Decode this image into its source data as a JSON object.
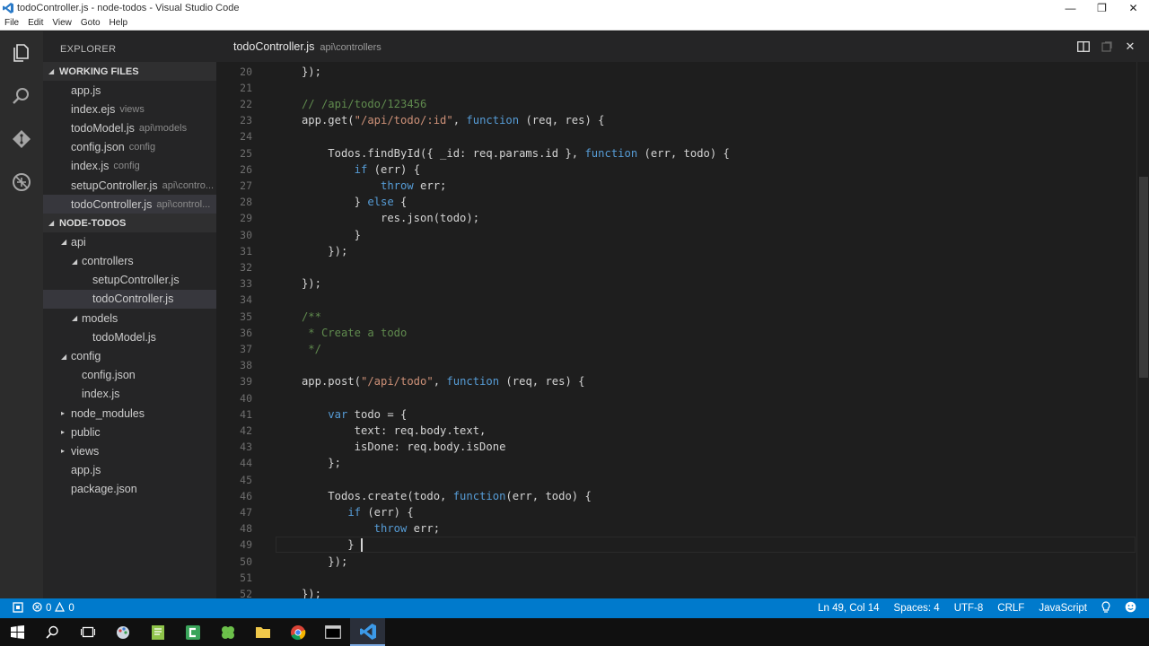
{
  "window": {
    "title": "todoController.js - node-todos - Visual Studio Code",
    "controls": [
      "—",
      "❐",
      "✕"
    ]
  },
  "menu": [
    "File",
    "Edit",
    "View",
    "Goto",
    "Help"
  ],
  "sidebar": {
    "header": "EXPLORER",
    "working_files_label": "WORKING FILES",
    "working_files": [
      {
        "name": "app.js",
        "hint": ""
      },
      {
        "name": "index.ejs",
        "hint": "views"
      },
      {
        "name": "todoModel.js",
        "hint": "api\\models"
      },
      {
        "name": "config.json",
        "hint": "config"
      },
      {
        "name": "index.js",
        "hint": "config"
      },
      {
        "name": "setupController.js",
        "hint": "api\\contro..."
      },
      {
        "name": "todoController.js",
        "hint": "api\\control..."
      }
    ],
    "project_label": "NODE-TODOS",
    "tree": [
      {
        "name": "api",
        "depth": 1,
        "toggle": "open"
      },
      {
        "name": "controllers",
        "depth": 2,
        "toggle": "open"
      },
      {
        "name": "setupController.js",
        "depth": 3,
        "toggle": ""
      },
      {
        "name": "todoController.js",
        "depth": 3,
        "toggle": "",
        "selected": true
      },
      {
        "name": "models",
        "depth": 2,
        "toggle": "open"
      },
      {
        "name": "todoModel.js",
        "depth": 3,
        "toggle": ""
      },
      {
        "name": "config",
        "depth": 1,
        "toggle": "open"
      },
      {
        "name": "config.json",
        "depth": 2,
        "toggle": ""
      },
      {
        "name": "index.js",
        "depth": 2,
        "toggle": ""
      },
      {
        "name": "node_modules",
        "depth": 1,
        "toggle": "closed"
      },
      {
        "name": "public",
        "depth": 1,
        "toggle": "closed"
      },
      {
        "name": "views",
        "depth": 1,
        "toggle": "closed"
      },
      {
        "name": "app.js",
        "depth": 1,
        "toggle": ""
      },
      {
        "name": "package.json",
        "depth": 1,
        "toggle": ""
      }
    ]
  },
  "tab": {
    "name": "todoController.js",
    "path": "api\\controllers"
  },
  "editor": {
    "lines": [
      {
        "n": "20",
        "tokens": [
          [
            "    });",
            ""
          ]
        ]
      },
      {
        "n": "21",
        "tokens": []
      },
      {
        "n": "22",
        "tokens": [
          [
            "    // /api/todo/123456",
            "cm"
          ]
        ]
      },
      {
        "n": "23",
        "tokens": [
          [
            "    app.get(",
            ""
          ],
          [
            "\"/api/todo/:id\"",
            "str"
          ],
          [
            ", ",
            ""
          ],
          [
            "function",
            "kw"
          ],
          [
            " (req, res) {",
            ""
          ]
        ]
      },
      {
        "n": "24",
        "tokens": []
      },
      {
        "n": "25",
        "tokens": [
          [
            "        Todos.findById({ _id: req.params.id }, ",
            ""
          ],
          [
            "function",
            "kw"
          ],
          [
            " (err, todo) {",
            ""
          ]
        ]
      },
      {
        "n": "26",
        "tokens": [
          [
            "            ",
            ""
          ],
          [
            "if",
            "kw"
          ],
          [
            " (err) {",
            ""
          ]
        ]
      },
      {
        "n": "27",
        "tokens": [
          [
            "                ",
            ""
          ],
          [
            "throw",
            "kw"
          ],
          [
            " err;",
            ""
          ]
        ]
      },
      {
        "n": "28",
        "tokens": [
          [
            "            } ",
            ""
          ],
          [
            "else",
            "kw"
          ],
          [
            " {",
            ""
          ]
        ]
      },
      {
        "n": "29",
        "tokens": [
          [
            "                res.json(todo);",
            ""
          ]
        ]
      },
      {
        "n": "30",
        "tokens": [
          [
            "            }",
            ""
          ]
        ]
      },
      {
        "n": "31",
        "tokens": [
          [
            "        });",
            ""
          ]
        ]
      },
      {
        "n": "32",
        "tokens": []
      },
      {
        "n": "33",
        "tokens": [
          [
            "    });",
            ""
          ]
        ]
      },
      {
        "n": "34",
        "tokens": []
      },
      {
        "n": "35",
        "tokens": [
          [
            "    /**",
            "cm"
          ]
        ]
      },
      {
        "n": "36",
        "tokens": [
          [
            "     * Create a todo",
            "cm"
          ]
        ]
      },
      {
        "n": "37",
        "tokens": [
          [
            "     */",
            "cm"
          ]
        ]
      },
      {
        "n": "38",
        "tokens": []
      },
      {
        "n": "39",
        "tokens": [
          [
            "    app.post(",
            ""
          ],
          [
            "\"/api/todo\"",
            "str"
          ],
          [
            ", ",
            ""
          ],
          [
            "function",
            "kw"
          ],
          [
            " (req, res) {",
            ""
          ]
        ]
      },
      {
        "n": "40",
        "tokens": []
      },
      {
        "n": "41",
        "tokens": [
          [
            "        ",
            ""
          ],
          [
            "var",
            "kw"
          ],
          [
            " todo = {",
            ""
          ]
        ]
      },
      {
        "n": "42",
        "tokens": [
          [
            "            text: req.body.text,",
            ""
          ]
        ]
      },
      {
        "n": "43",
        "tokens": [
          [
            "            isDone: req.body.isDone",
            ""
          ]
        ]
      },
      {
        "n": "44",
        "tokens": [
          [
            "        };",
            ""
          ]
        ]
      },
      {
        "n": "45",
        "tokens": []
      },
      {
        "n": "46",
        "tokens": [
          [
            "        Todos.create(todo, ",
            ""
          ],
          [
            "function",
            "kw"
          ],
          [
            "(err, todo) {",
            ""
          ]
        ]
      },
      {
        "n": "47",
        "tokens": [
          [
            "           ",
            ""
          ],
          [
            "if",
            "kw"
          ],
          [
            " (err) {",
            ""
          ]
        ]
      },
      {
        "n": "48",
        "tokens": [
          [
            "               ",
            ""
          ],
          [
            "throw",
            "kw"
          ],
          [
            " err;",
            ""
          ]
        ]
      },
      {
        "n": "49",
        "tokens": [
          [
            "           }",
            ""
          ]
        ],
        "current": true
      },
      {
        "n": "50",
        "tokens": [
          [
            "        });",
            ""
          ]
        ]
      },
      {
        "n": "51",
        "tokens": []
      },
      {
        "n": "52",
        "tokens": [
          [
            "    });",
            ""
          ]
        ]
      }
    ]
  },
  "status": {
    "errors": "0",
    "warnings": "0",
    "position": "Ln 49, Col 14",
    "spaces": "Spaces: 4",
    "encoding": "UTF-8",
    "eol": "CRLF",
    "language": "JavaScript"
  },
  "colors": {
    "accent": "#007acc",
    "keyword": "#569cd6",
    "string": "#ce9178",
    "comment": "#608b4e"
  },
  "taskbar_icons": [
    "windows-start-icon",
    "search-icon",
    "task-view-icon",
    "paint-icon",
    "notepad-plus-icon",
    "camtasia-icon",
    "clover-icon",
    "folder-icon",
    "chrome-icon",
    "terminal-icon",
    "vscode-icon"
  ]
}
